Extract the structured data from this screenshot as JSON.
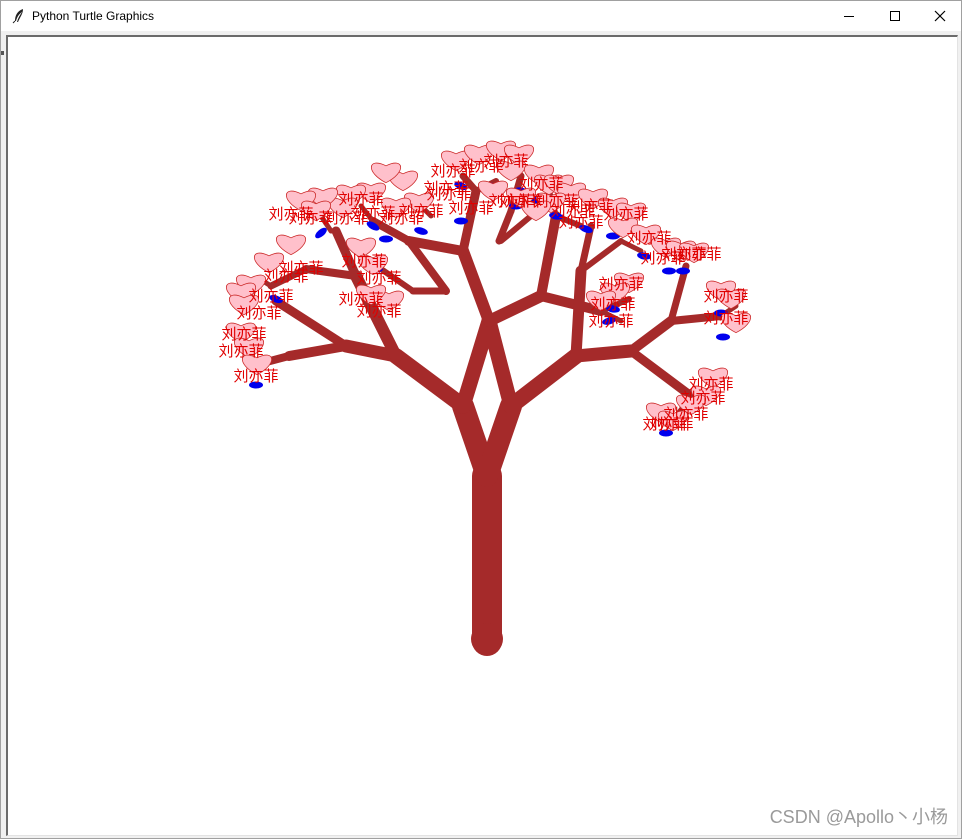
{
  "window": {
    "title": "Python Turtle Graphics",
    "icons": {
      "app": "feather-icon",
      "minimize": "minimize-icon",
      "maximize": "maximize-icon",
      "close": "close-icon"
    }
  },
  "drawing": {
    "leaf_label": "刘亦菲",
    "colors": {
      "trunk": "#a52a2a",
      "heart_fill": "#ffc0cb",
      "heart_stroke": "#cc2b2b",
      "leaf_label": "#e00000",
      "blue_petal": "#0000ee",
      "canvas_bg": "#ffffff"
    }
  },
  "watermark": {
    "text": "CSDN @Apollo丶小杨"
  }
}
